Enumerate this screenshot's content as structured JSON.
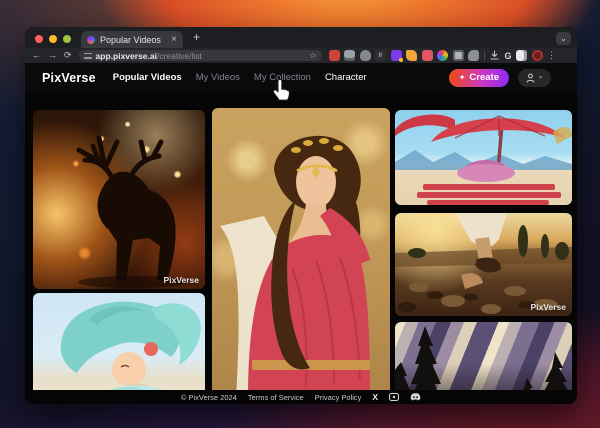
{
  "browser": {
    "traffic_lights": [
      "close",
      "minimize",
      "fullscreen"
    ],
    "tab": {
      "title": "Popular Videos",
      "close_icon": "×",
      "new_tab_icon": "+",
      "tab_menu_icon": "⌄"
    },
    "toolbar": {
      "back_icon": "←",
      "forward_icon": "→",
      "reload_icon": "⟳",
      "url_host": "app.pixverse.ai",
      "url_path": "/creative/list",
      "bookmark_icon": "☆",
      "fr_extension_label": "fr",
      "google_icon": "G",
      "menu_icon": "⋮",
      "extension_icons": [
        "red-extension-icon",
        "screen-extension-icon",
        "cloud-extension-icon",
        "fr-extension-icon",
        "purple-extension-icon",
        "orange-extension-icon",
        "photo-extension-icon",
        "color-wheel-extension-icon",
        "frame-extension-icon",
        "puzzle-extension-icon",
        "download-icon",
        "google-icon",
        "reader-extension-icon",
        "red-circle-extension-icon"
      ]
    }
  },
  "site": {
    "logo": "PixVerse",
    "nav": [
      {
        "label": "Popular Videos",
        "state": "active"
      },
      {
        "label": "My Videos",
        "state": "default"
      },
      {
        "label": "My Collection",
        "state": "default"
      },
      {
        "label": "Character",
        "state": "hovered"
      }
    ],
    "create_button": {
      "label": "Create",
      "icon": "✦"
    },
    "user_menu": {
      "avatar_icon": "person-icon",
      "chevron_icon": "⌄"
    },
    "gallery": [
      {
        "name": "moose-in-fire-sparks-video",
        "watermark": "PixVerse"
      },
      {
        "name": "anime-girl-teal-hair-video",
        "watermark": ""
      },
      {
        "name": "greek-goddess-red-dress-video",
        "watermark": ""
      },
      {
        "name": "cartoon-beach-umbrella-video",
        "watermark": ""
      },
      {
        "name": "barefoot-walk-dirt-path-video",
        "watermark": "PixVerse"
      },
      {
        "name": "aurora-pine-forest-video",
        "watermark": ""
      }
    ],
    "footer": {
      "copyright": "© PixVerse 2024",
      "links": [
        "Terms of Service",
        "Privacy Policy"
      ],
      "social_icons": [
        "x-icon",
        "video-icon",
        "discord-icon"
      ]
    }
  },
  "colors": {
    "create_gradient_start": "#f1490f",
    "create_gradient_end": "#8e2bf2",
    "page_bg": "#050505",
    "nav_active_text": "#ffffff",
    "nav_inactive_text": "#85858b"
  }
}
